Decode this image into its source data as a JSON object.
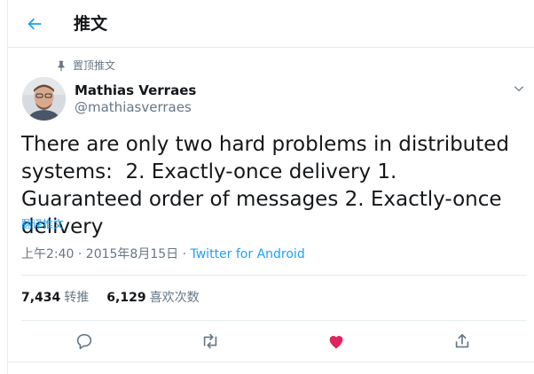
{
  "header": {
    "title": "推文",
    "back_icon": "arrow-left-icon"
  },
  "tweet": {
    "pinned_label": "置顶推文",
    "author": {
      "display_name": "Mathias Verraes",
      "handle": "@mathiasverraes"
    },
    "text": "There are only two hard problems in distributed systems:  2. Exactly-once delivery 1. Guaranteed order of messages 2. Exactly-once delivery",
    "translate_label": "翻译推文",
    "timestamp": "上午2:40 · 2015年8月15日 ·",
    "source": "Twitter for Android"
  },
  "stats": {
    "retweets": {
      "count": "7,434",
      "label": "转推"
    },
    "likes": {
      "count": "6,129",
      "label": "喜欢次数"
    }
  },
  "actions": [
    "reply-icon",
    "retweet-icon",
    "like-icon",
    "share-icon"
  ],
  "colors": {
    "accent": "#1da1f2",
    "like": "#e0245e",
    "text_secondary": "#657786",
    "border": "#e6ecf0"
  }
}
